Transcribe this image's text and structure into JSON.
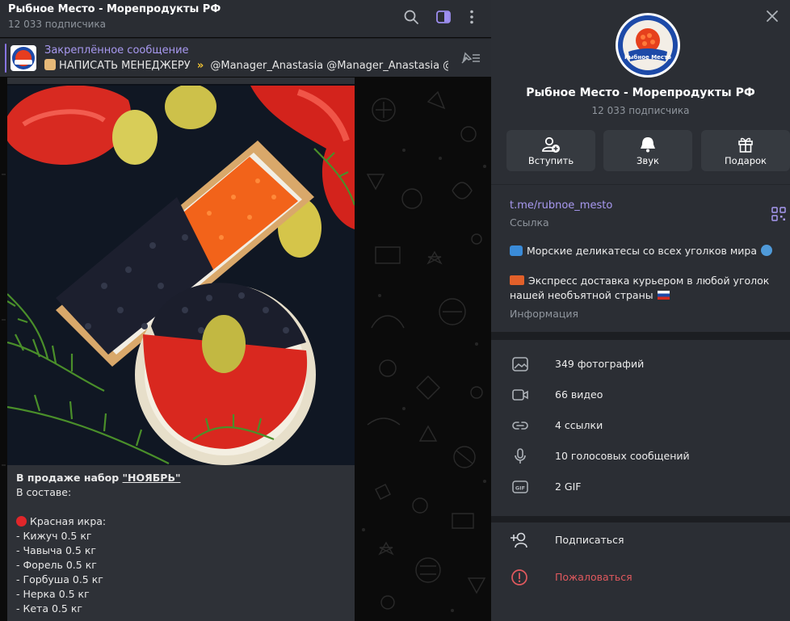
{
  "chat": {
    "title": "Рыбное Место - Морепродукты РФ",
    "subtitle": "12 033 подписчика",
    "pinned_label": "Закреплённое сообщение",
    "pinned_text": "НАПИСАТЬ МЕНЕДЖЕРУ",
    "pinned_mentions": "@Manager_Anastasia @Manager_Anastasia @..."
  },
  "message": {
    "lines": [
      {
        "prefix": "В продаже набор ",
        "link": "\"НОЯБРЬ\""
      },
      {
        "text": "В составе:"
      },
      {
        "text": ""
      },
      {
        "text": "Красная икра:"
      },
      {
        "text": "- Кижуч 0.5 кг"
      },
      {
        "text": "- Чавыча 0.5 кг"
      },
      {
        "text": "- Форель 0.5 кг"
      },
      {
        "text": "- Горбуша 0.5 кг"
      },
      {
        "text": "- Нерка 0.5 кг"
      },
      {
        "text": "- Кета 0.5 кг"
      }
    ]
  },
  "panel": {
    "title": "Рыбное Место - Морепродукты РФ",
    "subtitle": "12 033 подписчика",
    "avatar_text": "Рыбное Место",
    "actions": [
      {
        "label": "Вступить",
        "icon": "add-user-icon"
      },
      {
        "label": "Звук",
        "icon": "bell-icon"
      },
      {
        "label": "Подарок",
        "icon": "gift-icon"
      }
    ],
    "link": "t.me/rubnoe_mesto",
    "link_sub": "Ссылка",
    "desc_line1": "Морские деликатесы со всех уголков мира",
    "desc_line2": "Экспресс доставка курьером в любой уголок",
    "desc_line3": "нашей необъятной страны",
    "desc_sub": "Информация",
    "media": [
      {
        "label": "349 фотографий",
        "icon": "photo-icon"
      },
      {
        "label": "66 видео",
        "icon": "video-icon"
      },
      {
        "label": "4 ссылки",
        "icon": "link-icon"
      },
      {
        "label": "10 голосовых сообщений",
        "icon": "microphone-icon"
      },
      {
        "label": "2 GIF",
        "icon": "gif-icon"
      }
    ],
    "subscribe": "Подписаться",
    "report": "Пожаловаться"
  },
  "colors": {
    "accent": "#a899f0",
    "danger": "#e0595e",
    "panel_bg": "#2b2e34",
    "chat_bg": "#0b0b0b"
  }
}
